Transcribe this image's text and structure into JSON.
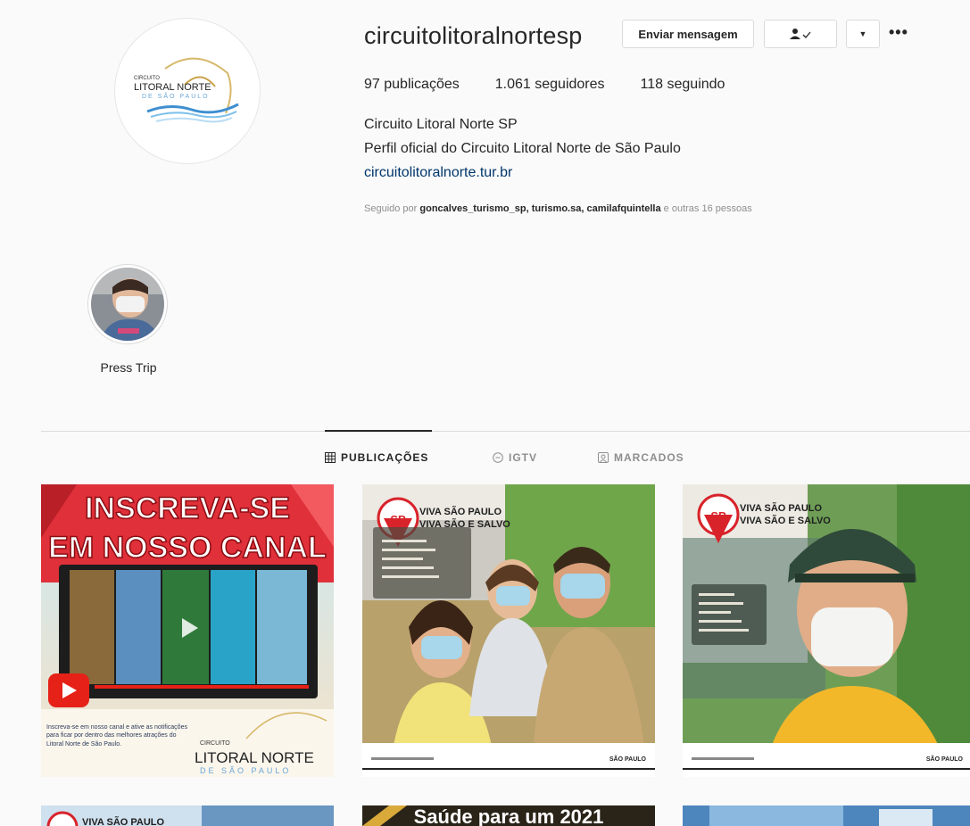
{
  "profile": {
    "username": "circuitolitoralnortesp",
    "buttons": {
      "message": "Enviar mensagem",
      "following_icon": "person-check-icon",
      "dropdown_icon": "triangle-down-icon",
      "more_icon": "more-dots-icon"
    },
    "stats": {
      "posts": "97",
      "posts_label": "publicações",
      "followers": "1.061",
      "followers_label": "seguidores",
      "following": "118",
      "following_label": "seguindo"
    },
    "full_name": "Circuito Litoral Norte SP",
    "bio": "Perfil oficial do Circuito Litoral Norte de São Paulo",
    "website": "circuitolitoralnorte.tur.br",
    "followed_by_prefix": "Seguido por",
    "followed_by_names": "goncalves_turismo_sp, turismo.sa, camilafquintella",
    "followed_by_suffix": "e outras 16 pessoas"
  },
  "logo": {
    "line1": "CIRCUITO",
    "line2": "LITORAL NORTE",
    "line3": "DE SÃO PAULO"
  },
  "highlight": {
    "label": "Press Trip"
  },
  "tabs": [
    {
      "label": "PUBLICAÇÕES",
      "icon": "grid-icon",
      "active": true
    },
    {
      "label": "IGTV",
      "icon": "igtv-icon",
      "active": false
    },
    {
      "label": "MARCADOS",
      "icon": "tagged-icon",
      "active": false
    }
  ],
  "posts": {
    "p1": {
      "title1": "INSCREVA-SE",
      "title2": "EM NOSSO CANAL",
      "caption": "Inscreva-se em nosso canal e ative as notificações para ficar por dentro das melhores atrações do Litoral Norte de São Paulo.",
      "logo1": "CIRCUITO",
      "logo2": "LITORAL NORTE",
      "logo3": "DE SÃO PAULO"
    },
    "p2": {
      "badge": "SP",
      "line1": "VIVA SÃO PAULO",
      "line2": "VIVA SÃO E SALVO",
      "footer_logo": "SÃO PAULO"
    },
    "p3": {
      "badge": "SP",
      "line1": "VIVA SÃO PAULO",
      "line2": "VIVA SÃO E SALVO",
      "footer_logo": "SÃO PAULO"
    },
    "p4": {
      "text": "VIVA SÃO PAULO"
    },
    "p5": {
      "text": "Saúde para um 2021"
    }
  },
  "colors": {
    "link": "#00376b",
    "muted": "#8e8e8e",
    "youtube_red": "#e62117",
    "sp_red": "#d8232a"
  }
}
